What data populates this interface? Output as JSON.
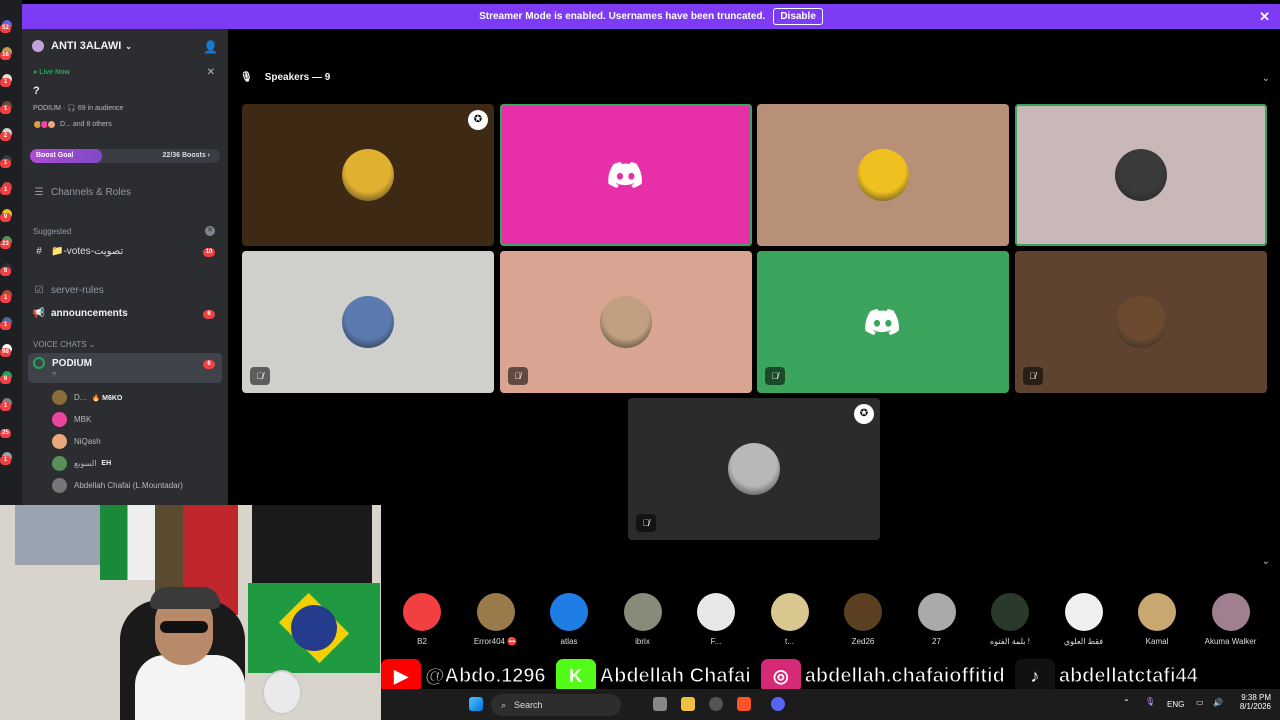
{
  "banner": {
    "text": "Streamer Mode is enabled. Usernames have been truncated.",
    "disable_label": "Disable",
    "close": "✕"
  },
  "server_badges": [
    "52",
    "16",
    "1",
    "1",
    "2",
    "1",
    "1",
    "9",
    "23",
    "6",
    "1",
    "1",
    "98",
    "6",
    "1",
    "25",
    "1"
  ],
  "sidebar": {
    "server_name": "ANTI 3ALAWI",
    "live_label": "Live Now",
    "stage_title": "?",
    "stage_meta": "PODIUM · 🎧 69 in audience",
    "stage_others": "D... and 8 others",
    "boost_label": "Boost Goal",
    "boost_count": "22/36 Boosts",
    "boost_progress": 0.611,
    "channels_roles": "Channels & Roles",
    "suggested_label": "Suggested",
    "suggested_channel": "📁-votes-تصويت",
    "suggested_badge": "10",
    "server_rules": "server-rules",
    "announcements": "announcements",
    "announcements_badge": "6",
    "voice_category": "VOICE CHATS",
    "podium": "PODIUM",
    "podium_sub": "?",
    "podium_badge": "6",
    "voice_users": [
      {
        "name": "D...",
        "tag": "🔥 M6KO",
        "color": "#8a6d3b"
      },
      {
        "name": "MBK",
        "tag": "",
        "color": "#eb459e"
      },
      {
        "name": "NiQash",
        "tag": "",
        "color": "#e8a87c"
      },
      {
        "name": "السوبع",
        "tag": "EH",
        "color": "#5a8f5a"
      },
      {
        "name": "Abdellah Chafai (L.Mountadar)",
        "tag": "",
        "color": "#777"
      }
    ]
  },
  "stage": {
    "speakers_label": "Speakers — 9",
    "tiles": [
      {
        "bg": "#3d2914",
        "avatar": "#e0b030",
        "muted": false,
        "mod": true,
        "speaking": false,
        "discord": false
      },
      {
        "bg": "#e72fa9",
        "avatar": "",
        "muted": false,
        "mod": false,
        "speaking": true,
        "discord": true
      },
      {
        "bg": "#b89078",
        "avatar": "#f0c020",
        "muted": false,
        "mod": false,
        "speaking": false,
        "discord": false
      },
      {
        "bg": "#c8b8b8",
        "avatar": "#3a3a3a",
        "muted": false,
        "mod": false,
        "speaking": true,
        "discord": false
      },
      {
        "bg": "#cfcfcb",
        "avatar": "#5a7ab0",
        "muted": true,
        "mod": false,
        "speaking": false,
        "discord": false
      },
      {
        "bg": "#d9a592",
        "avatar": "#c0a080",
        "muted": true,
        "mod": false,
        "speaking": false,
        "discord": false
      },
      {
        "bg": "#3ba55d",
        "avatar": "",
        "muted": true,
        "mod": false,
        "speaking": false,
        "discord": true
      },
      {
        "bg": "#5e4430",
        "avatar": "#6b4a30",
        "muted": true,
        "mod": false,
        "speaking": false,
        "discord": false
      },
      {
        "bg": "#2b2b2b",
        "avatar": "#b8b8b8",
        "muted": true,
        "mod": true,
        "speaking": false,
        "discord": false
      }
    ]
  },
  "audience": [
    {
      "name": "B2",
      "color": "#f23f42"
    },
    {
      "name": "Error404 ⛔",
      "color": "#9a7a4a"
    },
    {
      "name": "atlas",
      "color": "#1e7ee6"
    },
    {
      "name": "ibrix",
      "color": "#8a8a7a"
    },
    {
      "name": "F...",
      "color": "#e8e8e8"
    },
    {
      "name": "t...",
      "color": "#d8c890"
    },
    {
      "name": "Zed26",
      "color": "#5a4020"
    },
    {
      "name": "27",
      "color": "#aaaaaa"
    },
    {
      "name": "بلمة الفتوه !",
      "color": "#2a3a2a"
    },
    {
      "name": "فقط العلوي",
      "color": "#f0f0f0"
    },
    {
      "name": "Kamal",
      "color": "#c8a870"
    },
    {
      "name": "Akuma Walker",
      "color": "#a08090"
    }
  ],
  "socials": [
    {
      "icon": "youtube-icon",
      "text": "@Abdo.1296",
      "color": "#ff0000"
    },
    {
      "icon": "kick-icon",
      "text": "Abdellah Chafai",
      "color": "#53fc18"
    },
    {
      "icon": "instagram-icon",
      "text": "abdellah.chafaioffitid",
      "color": "#d62976"
    },
    {
      "icon": "tiktok-icon",
      "text": "abdellatctafi44",
      "color": "#111111"
    }
  ],
  "taskbar": {
    "search": "Search",
    "lang": "ENG",
    "time": "9:38 PM",
    "date": "8/1/2026"
  }
}
